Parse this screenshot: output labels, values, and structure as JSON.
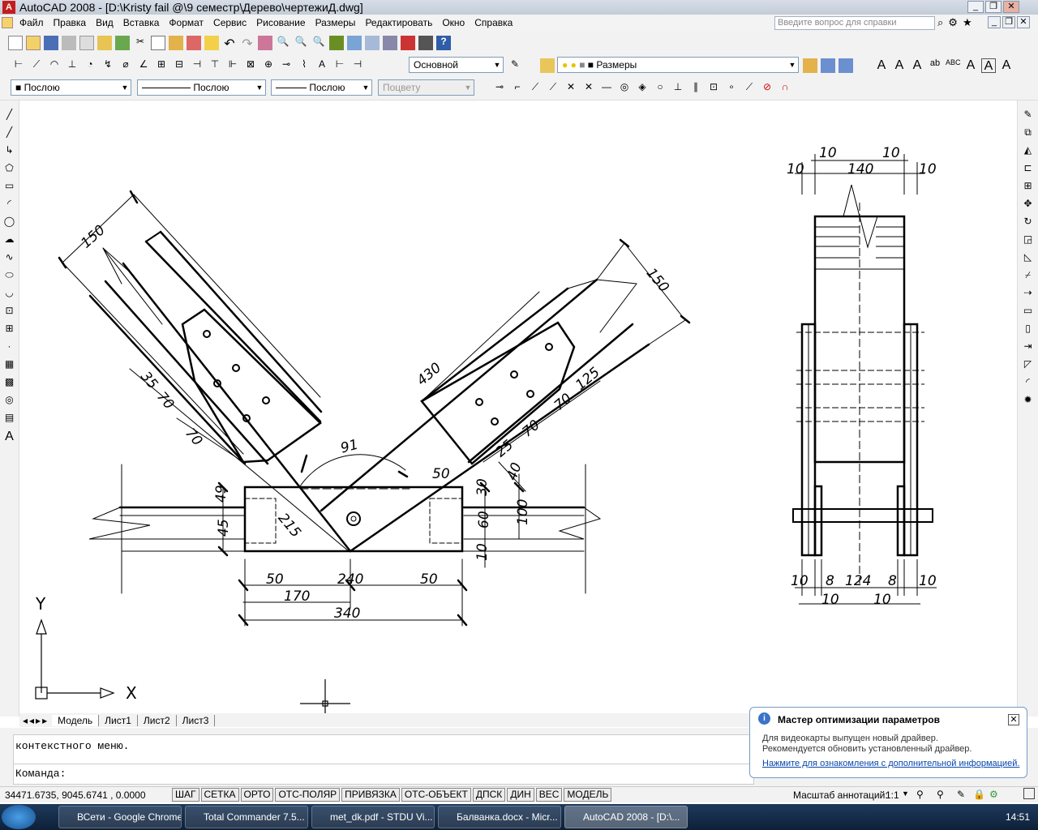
{
  "window": {
    "title": "AutoCAD 2008 - [D:\\Kristy fail @\\9 семестр\\Дерево\\чертежиД.dwg]"
  },
  "menu": [
    "Файл",
    "Правка",
    "Вид",
    "Вставка",
    "Формат",
    "Сервис",
    "Рисование",
    "Размеры",
    "Редактировать",
    "Окно",
    "Справка"
  ],
  "help_search": {
    "placeholder": "Введите вопрос для справки"
  },
  "toolbar": {
    "text_style": "Основной",
    "dim_style": "Размеры",
    "color": "Послою",
    "linetype": "Послою",
    "lineweight": "Послою",
    "plotstyle": "Поцвету"
  },
  "drawing": {
    "dims_left": [
      "150",
      "430",
      "150",
      "91",
      "35",
      "70",
      "70",
      "125",
      "70",
      "70",
      "25",
      "40",
      "50",
      "49",
      "45",
      "215",
      "30",
      "60",
      "100",
      "10",
      "50",
      "240",
      "50",
      "170",
      "340"
    ],
    "dims_right": [
      "10",
      "10",
      "10",
      "140",
      "10",
      "10",
      "8",
      "124",
      "8",
      "10",
      "10",
      "10"
    ],
    "ucs": {
      "y": "Y",
      "x": "X"
    }
  },
  "tabs": [
    "Модель",
    "Лист1",
    "Лист2",
    "Лист3"
  ],
  "command": {
    "history": "контекстного меню.",
    "prompt": "Команда:"
  },
  "status": {
    "coords": "34471.6735, 9045.6741 , 0.0000",
    "buttons": [
      "ШАГ",
      "СЕТКА",
      "ОРТО",
      "ОТС-ПОЛЯР",
      "ПРИВЯЗКА",
      "ОТС-ОБЪЕКТ",
      "ДПСК",
      "ДИН",
      "ВЕС",
      "МОДЕЛЬ"
    ],
    "annotation_scale_label": "Масштаб аннотаций:",
    "annotation_scale": "1:1"
  },
  "balloon": {
    "title": "Мастер оптимизации параметров",
    "line1": "Для видеокарты выпущен новый драйвер.",
    "line2": "Рекомендуется обновить установленный драйвер.",
    "link": "Нажмите для ознакомления с дополнительной информацией."
  },
  "taskbar": {
    "items": [
      "ВСети - Google Chrome",
      "Total Commander 7.5...",
      "met_dk.pdf - STDU Vi...",
      "Балванка.docx - Micr...",
      "AutoCAD 2008 - [D:\\..."
    ],
    "clock": "14:51"
  }
}
